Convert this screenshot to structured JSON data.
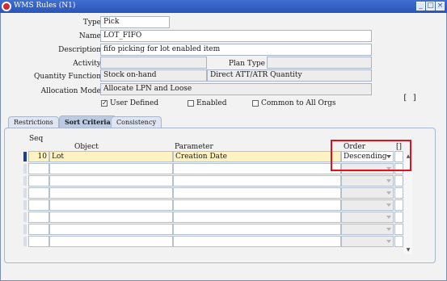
{
  "window": {
    "title": "WMS Rules (N1)"
  },
  "form": {
    "type_label": "Type",
    "type_value": "Pick",
    "name_label": "Name",
    "name_value": "LOT_FIFO",
    "description_label": "Description",
    "description_value": "fifo picking for lot enabled item",
    "activity_label": "Activity",
    "activity_value": "",
    "plan_type_label": "Plan Type",
    "plan_type_value": "",
    "quantity_function_label": "Quantity Function",
    "quantity_function_value": "Stock on-hand",
    "quantity_function_desc": "Direct ATT/ATR Quantity",
    "allocation_mode_label": "Allocation Mode",
    "allocation_mode_value": "Allocate LPN and Loose",
    "user_defined_label": "User Defined",
    "user_defined_checked": true,
    "enabled_label": "Enabled",
    "enabled_checked": false,
    "common_label": "Common to All Orgs",
    "common_checked": false,
    "bracket_button": "[ ]"
  },
  "tabs": [
    {
      "label": "Restrictions",
      "active": false
    },
    {
      "label": "Sort Criteria",
      "active": true
    },
    {
      "label": "Consistency",
      "active": false
    }
  ],
  "grid": {
    "headers": {
      "seq": "Seq",
      "object": "Object",
      "parameter": "Parameter",
      "order": "Order",
      "bracket": "[]"
    },
    "rows": [
      {
        "seq": "10",
        "object": "Lot",
        "parameter": "Creation Date",
        "order": "Descending"
      },
      {
        "seq": "",
        "object": "",
        "parameter": "",
        "order": ""
      },
      {
        "seq": "",
        "object": "",
        "parameter": "",
        "order": ""
      },
      {
        "seq": "",
        "object": "",
        "parameter": "",
        "order": ""
      },
      {
        "seq": "",
        "object": "",
        "parameter": "",
        "order": ""
      },
      {
        "seq": "",
        "object": "",
        "parameter": "",
        "order": ""
      },
      {
        "seq": "",
        "object": "",
        "parameter": "",
        "order": ""
      },
      {
        "seq": "",
        "object": "",
        "parameter": "",
        "order": ""
      }
    ]
  },
  "colors": {
    "highlight": "#e3101a",
    "selected_row": "#fdf3c2",
    "titlebar": "#2a55b8"
  }
}
